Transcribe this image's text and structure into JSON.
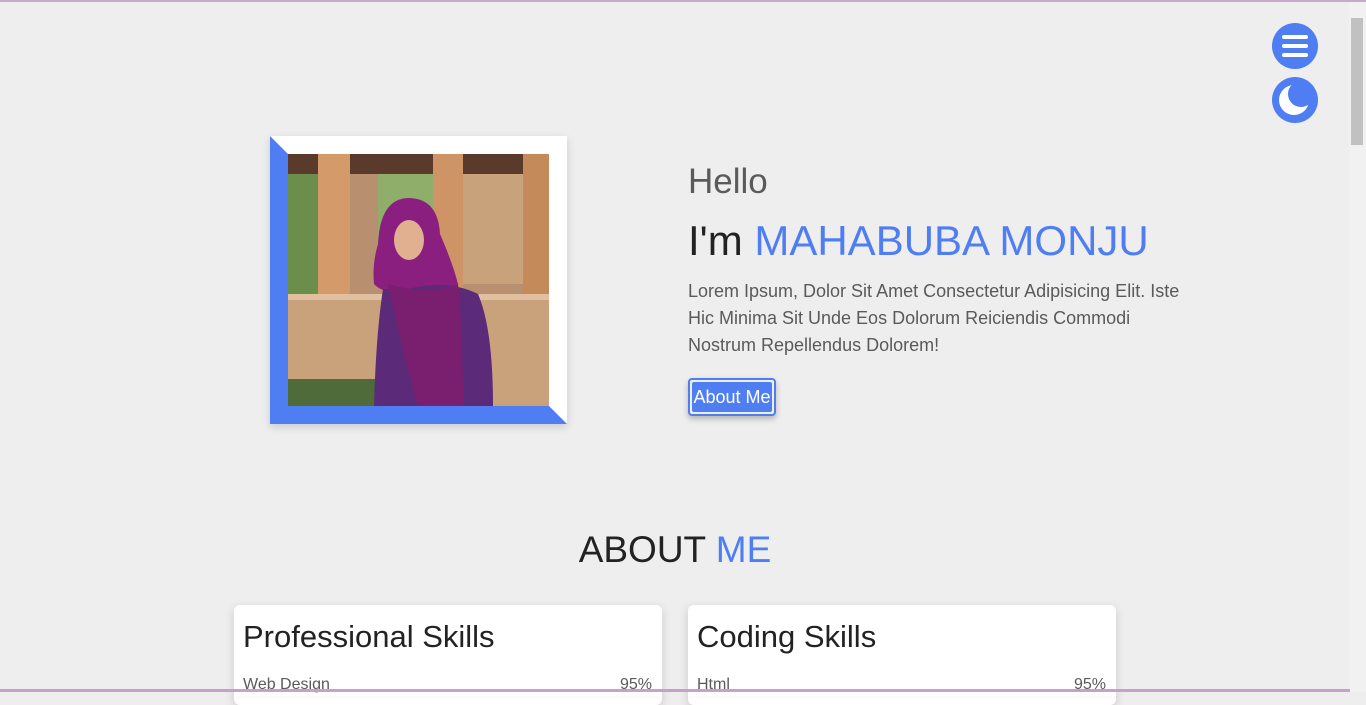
{
  "hero": {
    "greeting": "Hello",
    "intro_prefix": "I'm ",
    "name": "MAHABUBA MONJU",
    "bio": "Lorem Ipsum, Dolor Sit Amet Consectetur Adipisicing Elit. Iste Hic Minima Sit Unde Eos Dolorum Reiciendis Commodi Nostrum Repellendus Dolorem!",
    "button_label": "About Me"
  },
  "about": {
    "title_prefix": "ABOUT ",
    "title_highlight": "ME"
  },
  "cards": [
    {
      "title": "Professional Skills",
      "skills": [
        {
          "name": "Web Design",
          "percent": "95%"
        }
      ]
    },
    {
      "title": "Coding Skills",
      "skills": [
        {
          "name": "Html",
          "percent": "95%"
        }
      ]
    }
  ],
  "icons": {
    "menu": "hamburger-menu-icon",
    "theme": "moon-icon"
  },
  "colors": {
    "accent": "#4f7ef2",
    "background": "#eeeeee"
  }
}
